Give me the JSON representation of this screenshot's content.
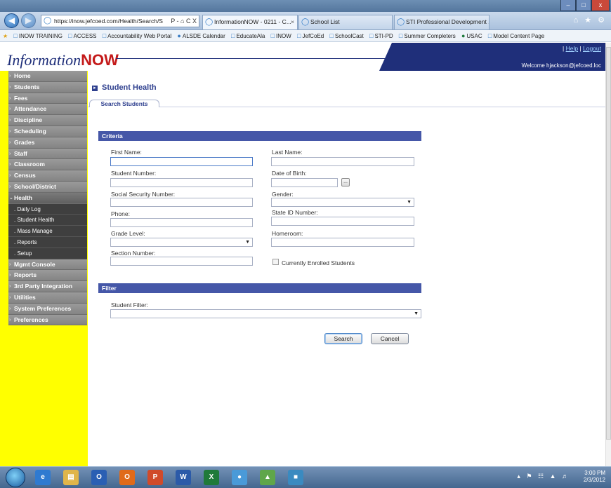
{
  "browser": {
    "url": "https://inow.jefcoed.com/Health/Search/S",
    "url_controls": "Ρ - ⌂ C X",
    "tabs": [
      {
        "label": "InformationNOW - 0211 - C...",
        "active": true
      },
      {
        "label": "School List",
        "active": false
      },
      {
        "label": "STI Professional Development ...",
        "active": false
      }
    ],
    "window_controls": {
      "minimize": "–",
      "maximize": "□",
      "close": "x"
    },
    "nav_icons": "⌂ ★ ⚙"
  },
  "favorites": [
    "INOW TRAINING",
    "ACCESS",
    "Accountability Web Portal",
    "ALSDE Calendar",
    "EducateAla",
    "INOW",
    "JefCoEd",
    "SchoolCast",
    "STI-PD",
    "Summer Completers",
    "USAC",
    "Model Content Page"
  ],
  "header": {
    "logo_text": "Information",
    "logo_bold": "NOW",
    "help": "Help",
    "logout": "Logout",
    "welcome": "Welcome hjackson@jefcoed.loc"
  },
  "menu": {
    "items_top": [
      "Home",
      "Students",
      "Fees",
      "Attendance",
      "Discipline",
      "Scheduling",
      "Grades",
      "Staff",
      "Classroom",
      "Census",
      "School/District"
    ],
    "open_item": "Health",
    "sub_items": [
      "Daily Log",
      "Student Health",
      "Mass Manage",
      "Reports",
      "Setup"
    ],
    "items_bottom": [
      "Mgmt Console",
      "Reports",
      "3rd Party Integration",
      "Utilities",
      "System Preferences",
      "Preferences"
    ]
  },
  "page": {
    "title": "Student Health",
    "tab": "Search Students"
  },
  "criteria": {
    "section_label": "Criteria",
    "first_name": {
      "label": "First Name:",
      "value": ""
    },
    "last_name": {
      "label": "Last Name:",
      "value": ""
    },
    "student_number": {
      "label": "Student Number:",
      "value": ""
    },
    "date_of_birth": {
      "label": "Date of Birth:",
      "value": "",
      "picker": "..."
    },
    "ssn": {
      "label": "Social Security Number:",
      "value": ""
    },
    "gender": {
      "label": "Gender:",
      "value": ""
    },
    "phone": {
      "label": "Phone:",
      "value": ""
    },
    "state_id": {
      "label": "State ID Number:",
      "value": ""
    },
    "grade_level": {
      "label": "Grade Level:",
      "value": ""
    },
    "homeroom": {
      "label": "Homeroom:",
      "value": ""
    },
    "section_number": {
      "label": "Section Number:",
      "value": ""
    },
    "enrolled": {
      "label": "Currently Enrolled Students",
      "checked": false
    }
  },
  "filter": {
    "section_label": "Filter",
    "student_filter": {
      "label": "Student Filter:",
      "value": ""
    }
  },
  "buttons": {
    "search": "Search",
    "cancel": "Cancel"
  },
  "taskbar": {
    "time": "3:00 PM",
    "date": "2/3/2012",
    "apps": [
      "IE",
      "Explorer",
      "Outlook",
      "Office",
      "PowerPoint",
      "Word",
      "Excel",
      "Chrome",
      "App",
      "App2"
    ]
  }
}
